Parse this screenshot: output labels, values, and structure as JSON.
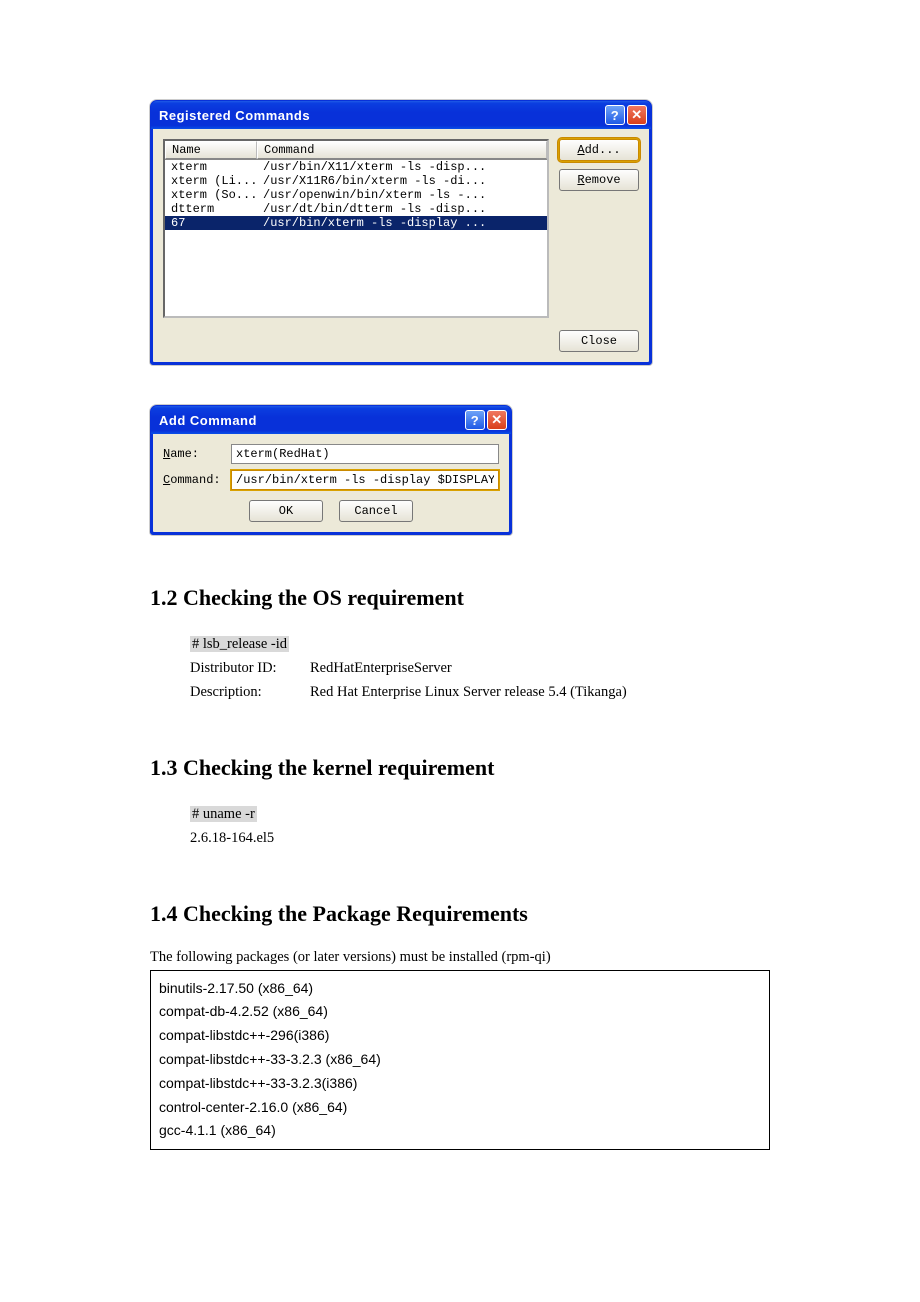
{
  "dialog1": {
    "title": "Registered Commands",
    "columns": {
      "name": "Name",
      "command": "Command"
    },
    "rows": [
      {
        "name": "xterm",
        "cmd": "/usr/bin/X11/xterm -ls -disp...",
        "selected": false
      },
      {
        "name": "xterm (Li...",
        "cmd": "/usr/X11R6/bin/xterm -ls -di...",
        "selected": false
      },
      {
        "name": "xterm (So...",
        "cmd": "/usr/openwin/bin/xterm -ls -...",
        "selected": false
      },
      {
        "name": "dtterm",
        "cmd": "/usr/dt/bin/dtterm -ls -disp...",
        "selected": false
      },
      {
        "name": "67",
        "cmd": "/usr/bin/xterm -ls -display ...",
        "selected": true
      }
    ],
    "buttons": {
      "add": "Add...",
      "remove": "Remove",
      "close": "Close"
    }
  },
  "dialog2": {
    "title": "Add Command",
    "labels": {
      "name": "Name:",
      "command": "Command:"
    },
    "fields": {
      "name": "xterm(RedHat)",
      "command": "/usr/bin/xterm -ls -display $DISPLAY"
    },
    "buttons": {
      "ok": "OK",
      "cancel": "Cancel"
    }
  },
  "sections": {
    "s12": {
      "heading": "1.2 Checking the OS requirement",
      "cmd": "# lsb_release -id",
      "lines": [
        {
          "key": "Distributor ID:",
          "val": "RedHatEnterpriseServer"
        },
        {
          "key": "Description:",
          "val": "Red Hat Enterprise Linux Server release 5.4 (Tikanga)"
        }
      ]
    },
    "s13": {
      "heading": "1.3 Checking the kernel requirement",
      "cmd": "# uname -r",
      "output": "2.6.18-164.el5"
    },
    "s14": {
      "heading": "1.4 Checking the Package Requirements",
      "intro": "The following packages (or later versions) must be installed (rpm-qi)",
      "packages": [
        "binutils-2.17.50 (x86_64)",
        "compat-db-4.2.52 (x86_64)",
        "compat-libstdc++-296(i386)",
        "compat-libstdc++-33-3.2.3 (x86_64)",
        "compat-libstdc++-33-3.2.3(i386)",
        "control-center-2.16.0 (x86_64)",
        "gcc-4.1.1 (x86_64)"
      ]
    }
  }
}
